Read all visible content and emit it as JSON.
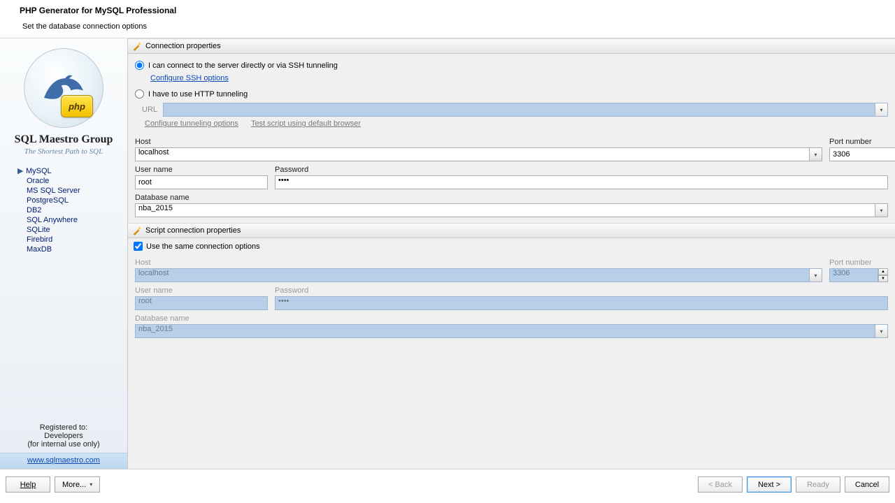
{
  "header": {
    "title": "PHP Generator for MySQL Professional",
    "subtitle": "Set the database connection options"
  },
  "brand": {
    "name": "SQL Maestro Group",
    "tagline": "The Shortest Path to SQL",
    "php_badge": "php"
  },
  "nav": {
    "items": [
      {
        "label": "MySQL",
        "selected": true
      },
      {
        "label": "Oracle"
      },
      {
        "label": "MS SQL Server"
      },
      {
        "label": "PostgreSQL"
      },
      {
        "label": "DB2"
      },
      {
        "label": "SQL Anywhere"
      },
      {
        "label": "SQLite"
      },
      {
        "label": "Firebird"
      },
      {
        "label": "MaxDB"
      }
    ]
  },
  "registration": {
    "line1": "Registered to:",
    "line2": "Developers",
    "line3": "(for internal use only)"
  },
  "site_link": "www.sqlmaestro.com",
  "sections": {
    "conn": "Connection properties",
    "script": "Script connection properties"
  },
  "radios": {
    "direct": "I can connect to the server directly or via SSH tunneling",
    "http": "I have to use HTTP tunneling"
  },
  "links": {
    "ssh": "Configure SSH options",
    "tun": "Configure tunneling options",
    "test": "Test script using default browser"
  },
  "labels": {
    "url": "URL",
    "host": "Host",
    "port": "Port number",
    "user": "User name",
    "pass": "Password",
    "db": "Database name"
  },
  "values": {
    "host": "localhost",
    "port": "3306",
    "user": "root",
    "pass": "••••",
    "db": "nba_2015",
    "script_host": "localhost",
    "script_port": "3306",
    "script_user": "root",
    "script_pass": "••••",
    "script_db": "nba_2015"
  },
  "check": {
    "same": "Use the same connection options"
  },
  "footer": {
    "help": "Help",
    "more": "More...",
    "back": "< Back",
    "next": "Next >",
    "ready": "Ready",
    "cancel": "Cancel"
  }
}
